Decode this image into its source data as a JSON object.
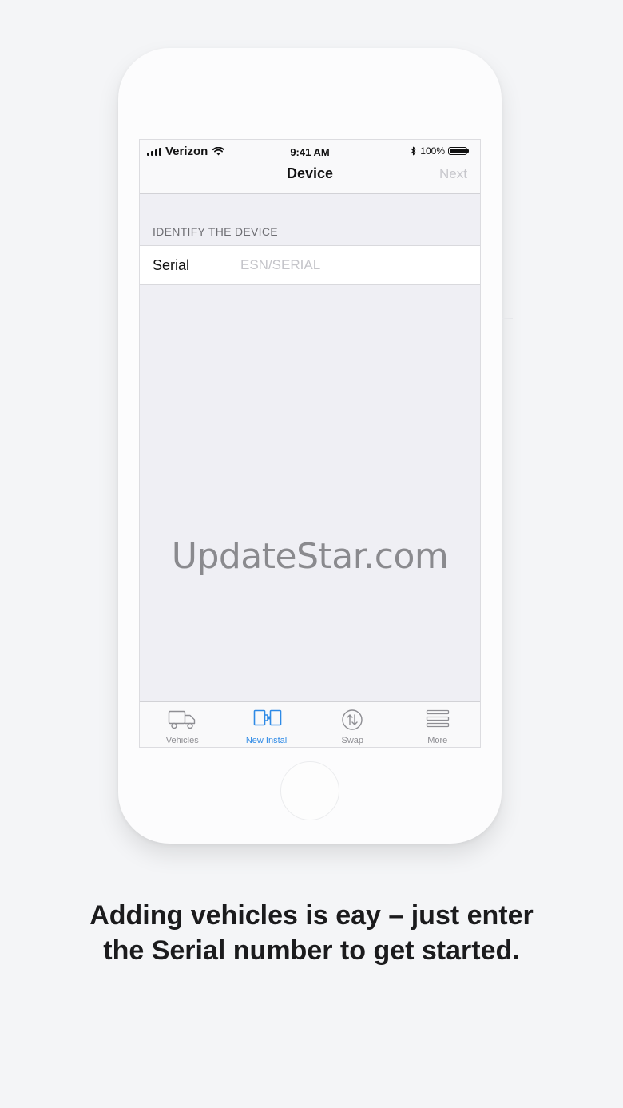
{
  "status_bar": {
    "carrier": "Verizon",
    "time": "9:41 AM",
    "battery": "100%"
  },
  "navbar": {
    "title": "Device",
    "next_label": "Next"
  },
  "section": {
    "header": "IDENTIFY THE DEVICE"
  },
  "form": {
    "serial_label": "Serial",
    "serial_value": "",
    "serial_placeholder": "ESN/SERIAL"
  },
  "watermark": "UpdateStar.com",
  "tabs": [
    {
      "label": "Vehicles",
      "icon": "truck-icon",
      "active": false
    },
    {
      "label": "New Install",
      "icon": "new-install-icon",
      "active": true
    },
    {
      "label": "Swap",
      "icon": "swap-icon",
      "active": false
    },
    {
      "label": "More",
      "icon": "menu-icon",
      "active": false
    }
  ],
  "colors": {
    "accent": "#2e8ae6",
    "inactive": "#8e8e93",
    "placeholder": "#c4c4c9"
  },
  "caption": "Adding vehicles is eay  –  just enter the Serial number to get started."
}
